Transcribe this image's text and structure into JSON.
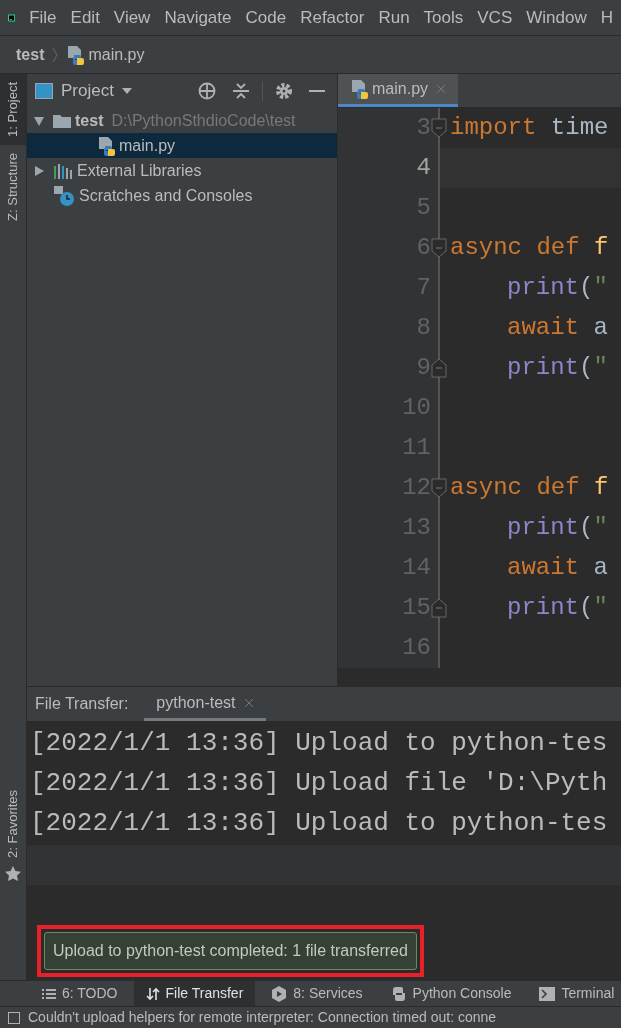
{
  "menu": [
    "File",
    "Edit",
    "View",
    "Navigate",
    "Code",
    "Refactor",
    "Run",
    "Tools",
    "VCS",
    "Window",
    "H"
  ],
  "breadcrumb": {
    "project": "test",
    "file": "main.py"
  },
  "left_strip": {
    "top": [
      {
        "label": "1: Project",
        "selected": true
      },
      {
        "label": "Z: Structure",
        "selected": false
      }
    ],
    "bottom": [
      "2: Favorites"
    ]
  },
  "project_panel": {
    "title": "Project",
    "tree": [
      {
        "label": "test",
        "path": "D:\\PythonSthdioCode\\test",
        "kind": "folder",
        "expanded": true,
        "selected": false,
        "children": [
          {
            "label": "main.py",
            "kind": "python",
            "selected": true
          }
        ]
      },
      {
        "label": "External Libraries",
        "kind": "libraries",
        "expanded": false,
        "selected": false
      },
      {
        "label": "Scratches and Consoles",
        "kind": "scratches",
        "selected": false
      }
    ]
  },
  "editor": {
    "tabs": [
      {
        "label": "main.py",
        "selected": true
      }
    ],
    "lines": [
      {
        "number": "3",
        "current": false,
        "fold_start": true,
        "fold_end": false,
        "indented": false,
        "tokens": [
          {
            "kind": "keyword",
            "text": "import"
          },
          {
            "kind": "plain",
            "text": " time"
          }
        ]
      },
      {
        "number": "4",
        "current": true,
        "fold_start": false,
        "fold_end": false
      },
      {
        "number": "5",
        "current": false,
        "fold_start": false,
        "fold_end": false
      },
      {
        "number": "6",
        "current": false,
        "fold_start": true,
        "fold_end": false,
        "indented": false,
        "tokens": [
          {
            "kind": "keyword",
            "text": "async def "
          },
          {
            "kind": "function",
            "text": "f"
          }
        ]
      },
      {
        "number": "7",
        "current": false,
        "fold_start": false,
        "fold_end": false,
        "indented": true,
        "tokens": [
          {
            "kind": "builtin",
            "text": "print"
          },
          {
            "kind": "plain",
            "text": "("
          },
          {
            "kind": "string",
            "text": "\""
          }
        ]
      },
      {
        "number": "8",
        "current": false,
        "fold_start": false,
        "fold_end": false,
        "indented": true,
        "tokens": [
          {
            "kind": "keyword",
            "text": "await"
          },
          {
            "kind": "plain",
            "text": " a"
          }
        ]
      },
      {
        "number": "9",
        "current": false,
        "fold_start": false,
        "fold_end": true,
        "indented": true,
        "tokens": [
          {
            "kind": "builtin",
            "text": "print"
          },
          {
            "kind": "plain",
            "text": "("
          },
          {
            "kind": "string",
            "text": "\""
          }
        ]
      },
      {
        "number": "10",
        "current": false,
        "fold_start": false,
        "fold_end": false
      },
      {
        "number": "11",
        "current": false,
        "fold_start": false,
        "fold_end": false
      },
      {
        "number": "12",
        "current": false,
        "fold_start": true,
        "fold_end": false,
        "indented": false,
        "tokens": [
          {
            "kind": "keyword",
            "text": "async def "
          },
          {
            "kind": "function",
            "text": "f"
          }
        ]
      },
      {
        "number": "13",
        "current": false,
        "fold_start": false,
        "fold_end": false,
        "indented": true,
        "tokens": [
          {
            "kind": "builtin",
            "text": "print"
          },
          {
            "kind": "plain",
            "text": "("
          },
          {
            "kind": "string",
            "text": "\""
          }
        ]
      },
      {
        "number": "14",
        "current": false,
        "fold_start": false,
        "fold_end": false,
        "indented": true,
        "tokens": [
          {
            "kind": "keyword",
            "text": "await"
          },
          {
            "kind": "plain",
            "text": " a"
          }
        ]
      },
      {
        "number": "15",
        "current": false,
        "fold_start": false,
        "fold_end": true,
        "indented": true,
        "tokens": [
          {
            "kind": "builtin",
            "text": "print"
          },
          {
            "kind": "plain",
            "text": "("
          },
          {
            "kind": "string",
            "text": "\""
          }
        ]
      },
      {
        "number": "16",
        "current": false,
        "fold_start": false,
        "fold_end": false
      }
    ]
  },
  "file_transfer": {
    "label": "File Transfer:",
    "tabs": [
      {
        "label": "python-test",
        "selected": true
      }
    ],
    "log": [
      "[2022/1/1 13:36] Upload to python-tes",
      "[2022/1/1 13:36] Upload file 'D:\\Pyth",
      "[2022/1/1 13:36] Upload to python-tes"
    ]
  },
  "notification": "Upload to python-test completed: 1 file transferred",
  "tool_tabs": [
    {
      "label": "6: TODO",
      "kind": "todo",
      "selected": false
    },
    {
      "label": "File Transfer",
      "kind": "transfer",
      "selected": true
    },
    {
      "label": "8: Services",
      "kind": "services",
      "selected": false
    },
    {
      "label": "Python Console",
      "kind": "python",
      "selected": false
    },
    {
      "label": "Terminal",
      "kind": "terminal",
      "selected": false
    }
  ],
  "status_bar": "Couldn't upload helpers for remote interpreter: Connection timed out: conne"
}
